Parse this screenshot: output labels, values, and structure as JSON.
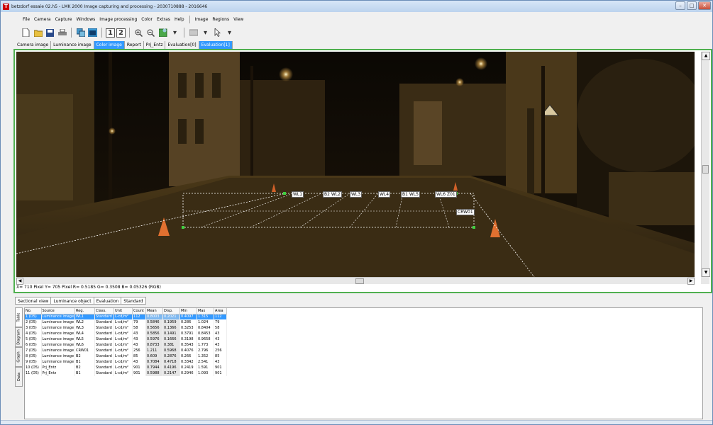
{
  "window": {
    "title": "betzdorf essaie 02.h5 - LMK 2000 Image capturing and processing - 2030710888 - 2016646",
    "icon": "T",
    "buttons": [
      "–",
      "□",
      "✕"
    ]
  },
  "menu": {
    "group1": [
      "File",
      "Camera",
      "Capture",
      "Windows",
      "Image processing",
      "Color",
      "Extras",
      "Help"
    ],
    "group2": [
      "Image",
      "Regions",
      "View"
    ]
  },
  "toolbar": {
    "one_label": "1",
    "two_label": "2"
  },
  "tabs": [
    "Camera image",
    "Luminance image",
    "Color image",
    "Report",
    "Prj_Entz",
    "Evaluation[0]",
    "Evaluation[1]"
  ],
  "image": {
    "region_labels": [
      "WL1",
      "B2 WL2",
      "WL3",
      "WL4",
      "B1 WL5",
      "WL6 Z01",
      "CRW01"
    ],
    "status": "X= 710 Pixel  Y= 705 Pixel  R= 0.5185    G= 0.3508    B= 0.05326    (RGB)"
  },
  "lower_tabs": [
    "Sectional view",
    "Luminance object",
    "Evaluation",
    "Standard"
  ],
  "side_tabs": [
    "Table",
    "Diagram",
    "Graph",
    "Data"
  ],
  "table": {
    "columns": [
      "No.",
      "Source",
      "Reg.",
      "Class.",
      "Unit",
      "Count",
      "Mean",
      "Disp.",
      "Min",
      "Max",
      "Area"
    ],
    "rows": [
      [
        "1 (D5)",
        "Luminance image",
        "WL1",
        "Standard",
        "L-cd/m²",
        "112",
        "0.8003",
        "0.2021",
        "0.4097",
        "1.315",
        "112"
      ],
      [
        "2 (D5)",
        "Luminance image",
        "WL2",
        "Standard",
        "L-cd/m²",
        "79",
        "0.5846",
        "0.1959",
        "0.286",
        "1.024",
        "79"
      ],
      [
        "3 (D5)",
        "Luminance image",
        "WL3",
        "Standard",
        "L-cd/m²",
        "58",
        "0.5656",
        "0.1366",
        "0.3253",
        "0.8404",
        "58"
      ],
      [
        "4 (D5)",
        "Luminance image",
        "WL4",
        "Standard",
        "L-cd/m²",
        "43",
        "0.5856",
        "0.1491",
        "0.3791",
        "0.8453",
        "43"
      ],
      [
        "5 (D5)",
        "Luminance image",
        "WL5",
        "Standard",
        "L-cd/m²",
        "43",
        "0.5976",
        "0.1666",
        "0.3198",
        "0.9658",
        "43"
      ],
      [
        "6 (D5)",
        "Luminance image",
        "WL6",
        "Standard",
        "L-cd/m²",
        "43",
        "0.8733",
        "0.381",
        "0.3543",
        "1.773",
        "43"
      ],
      [
        "7 (D5)",
        "Luminance image",
        "CRW01",
        "Standard",
        "L-cd/m²",
        "256",
        "1.211",
        "0.5968",
        "0.4076",
        "2.796",
        "256"
      ],
      [
        "8 (D5)",
        "Luminance image",
        "B2",
        "Standard",
        "L-cd/m²",
        "85",
        "0.609",
        "0.2876",
        "0.266",
        "1.352",
        "85"
      ],
      [
        "9 (D5)",
        "Luminance image",
        "B1",
        "Standard",
        "L-cd/m²",
        "43",
        "0.7084",
        "0.4718",
        "0.3342",
        "2.541",
        "43"
      ],
      [
        "10 (D5)",
        "Prj_Entz",
        "B2",
        "Standard",
        "L-cd/m²",
        "901",
        "0.7944",
        "0.4196",
        "0.2419",
        "1.591",
        "901"
      ],
      [
        "11 (D5)",
        "Prj_Entz",
        "B1",
        "Standard",
        "L-cd/m²",
        "901",
        "0.5988",
        "0.2147",
        "0.2946",
        "1.093",
        "901"
      ]
    ]
  },
  "colors": {
    "selection": "#3399ff",
    "frame_green": "#50b050",
    "scene_dark": "#1a1208"
  }
}
